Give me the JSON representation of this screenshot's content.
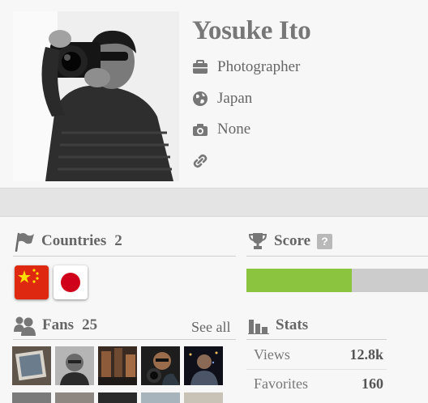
{
  "profile": {
    "name": "Yosuke Ito",
    "occupation": "Photographer",
    "country": "Japan",
    "camera": "None"
  },
  "countries": {
    "title": "Countries",
    "count": "2",
    "flags": [
      "china-flag",
      "japan-flag"
    ]
  },
  "score": {
    "title": "Score",
    "help": "?",
    "progress": 0.58,
    "fill_color": "#8bc53f",
    "track_color": "#cccccc"
  },
  "fans": {
    "title": "Fans",
    "count": "25",
    "see_all": "See all"
  },
  "stats": {
    "title": "Stats",
    "rows": [
      {
        "label": "Views",
        "value": "12.8k"
      },
      {
        "label": "Favorites",
        "value": "160"
      }
    ]
  }
}
